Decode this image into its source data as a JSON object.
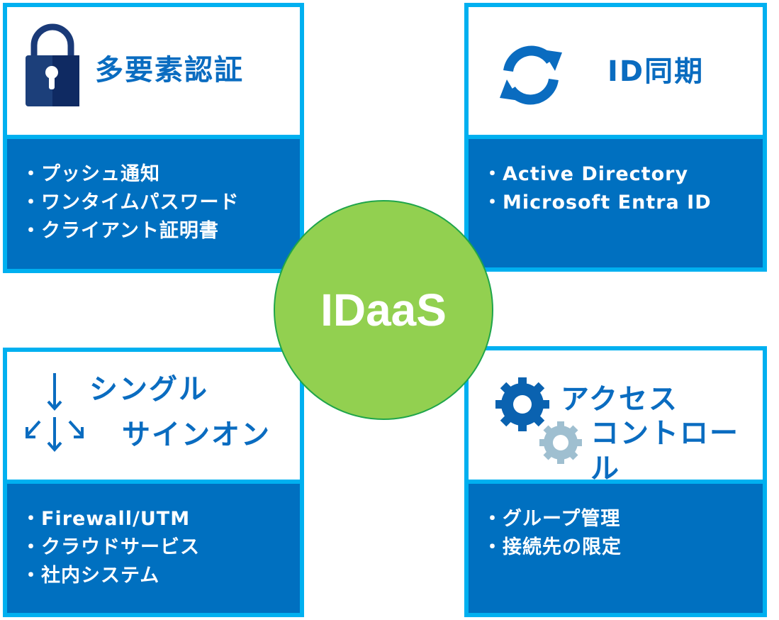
{
  "center": {
    "label": "IDaaS"
  },
  "cards": [
    {
      "title": "多要素認証",
      "icon": "lock-icon",
      "items": [
        "プッシュ通知",
        "ワンタイムパスワード",
        "クライアント証明書"
      ]
    },
    {
      "title": "ID同期",
      "icon": "sync-icon",
      "items": [
        "Active Directory",
        "Microsoft Entra ID"
      ]
    },
    {
      "title_lines": [
        "シングル",
        "サインオン"
      ],
      "icon": "branch-arrows-icon",
      "items": [
        "Firewall/UTM",
        "クラウドサービス",
        "社内システム"
      ]
    },
    {
      "title_lines": [
        "アクセス",
        "コントロール"
      ],
      "icon": "gears-icon",
      "items": [
        "グループ管理",
        "接続先の限定"
      ]
    }
  ],
  "colors": {
    "border": "#00b0f0",
    "fill": "#0070c0",
    "hub": "#92d050",
    "hub_border": "#1fa54a",
    "heading": "#0a6cc0"
  }
}
